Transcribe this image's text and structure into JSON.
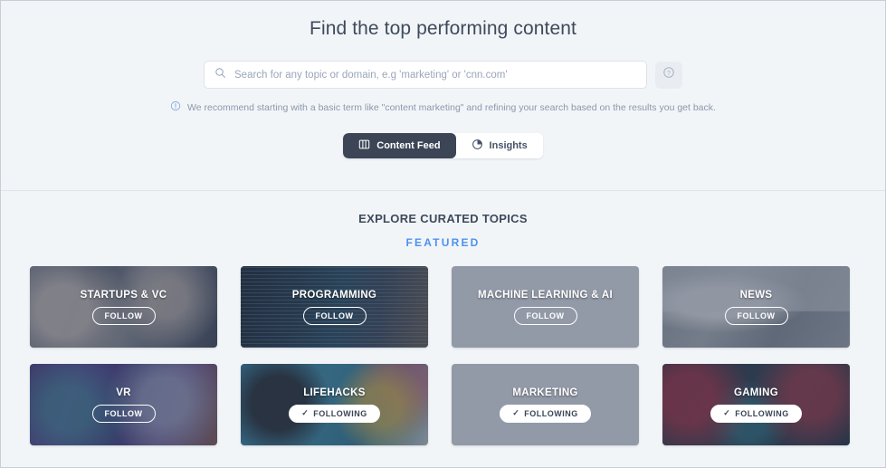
{
  "hero": {
    "title": "Find the top performing content",
    "search": {
      "placeholder": "Search for any topic or domain, e.g 'marketing' or 'cnn.com'",
      "value": "",
      "icon": "search-icon"
    },
    "help_button": {
      "icon": "question-circle-icon",
      "label": ""
    },
    "hint": {
      "icon": "info-circle-icon",
      "text": "We recommend starting with a basic term like \"content marketing\" and refining your search based on the results you get back."
    },
    "tabs": [
      {
        "label": "Content Feed",
        "icon": "panel-columns-icon",
        "active": true
      },
      {
        "label": "Insights",
        "icon": "pie-chart-icon",
        "active": false
      }
    ]
  },
  "topics": {
    "heading": "EXPLORE CURATED TOPICS",
    "subheading": "FEATURED",
    "cards": [
      {
        "title": "STARTUPS & VC",
        "button": "FOLLOW",
        "following": false,
        "art": "art-startups"
      },
      {
        "title": "PROGRAMMING",
        "button": "FOLLOW",
        "following": false,
        "art": "art-programming"
      },
      {
        "title": "MACHINE LEARNING & AI",
        "button": "FOLLOW",
        "following": false,
        "art": "art-ml"
      },
      {
        "title": "NEWS",
        "button": "FOLLOW",
        "following": false,
        "art": "art-news"
      },
      {
        "title": "VR",
        "button": "FOLLOW",
        "following": false,
        "art": "art-vr"
      },
      {
        "title": "LIFEHACKS",
        "button": "FOLLOWING",
        "following": true,
        "art": "art-lifehacks"
      },
      {
        "title": "MARKETING",
        "button": "FOLLOWING",
        "following": true,
        "art": "art-marketing"
      },
      {
        "title": "GAMING",
        "button": "FOLLOWING",
        "following": true,
        "art": "art-gaming"
      }
    ]
  },
  "colors": {
    "page_bg": "#f2f5f8",
    "tab_active_bg": "#3b4556",
    "featured_blue": "#4c92f0",
    "heading_text": "#3e4a5c",
    "hint_text": "#8b97ab"
  }
}
